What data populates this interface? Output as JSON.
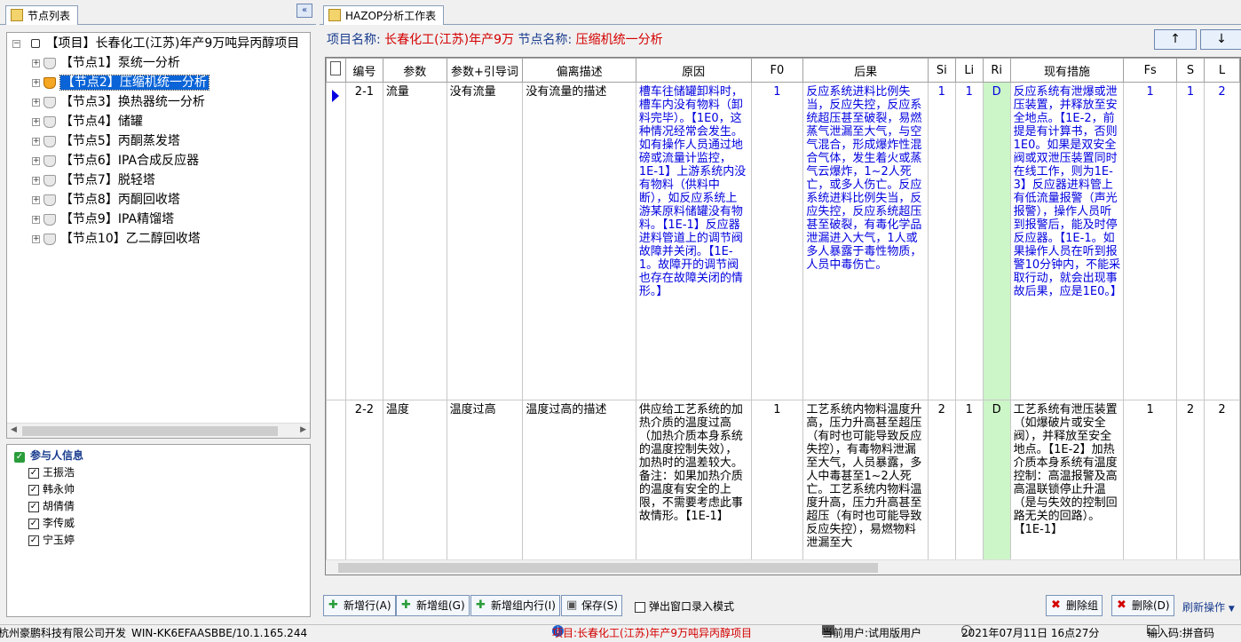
{
  "left_panel": {
    "tab_label": "节点列表",
    "collapse_glyph": "«",
    "tree": {
      "root": "【项目】长春化工(江苏)年产9万吨异丙醇项目",
      "nodes": [
        "【节点1】泵统一分析",
        "【节点2】压缩机统一分析",
        "【节点3】换热器统一分析",
        "【节点4】储罐",
        "【节点5】丙酮蒸发塔",
        "【节点6】IPA合成反应器",
        "【节点7】脱轻塔",
        "【节点8】丙酮回收塔",
        "【节点9】IPA精馏塔",
        "【节点10】乙二醇回收塔"
      ],
      "selected_index": 1
    },
    "participants": {
      "title": "参与人信息",
      "people": [
        "王振浩",
        "韩永帅",
        "胡倩倩",
        "李传威",
        "宁玉婷"
      ]
    }
  },
  "right_panel": {
    "tab_label": "HAZOP分析工作表",
    "project_label": "项目名称:",
    "project_value": "长春化工(江苏)年产9万",
    "node_label": "节点名称:",
    "node_value": "压缩机统一分析",
    "up_arrow": "↑",
    "down_arrow": "↓",
    "columns": [
      "编号",
      "参数",
      "参数+引导词",
      "偏离描述",
      "原因",
      "F0",
      "后果",
      "Si",
      "Li",
      "Ri",
      "现有措施",
      "Fs",
      "S",
      "L"
    ],
    "rows": [
      {
        "id": "2-1",
        "param": "流量",
        "guideword": "没有流量",
        "deviation": "没有流量的描述",
        "cause": "槽车往储罐卸料时，槽车内没有物料（卸料完毕）。【1E0，这种情况经常会发生。如有操作人员通过地磅或流量计监控，1E-1】上游系统内没有物料（供料中断），如反应系统上游某原料储罐没有物料。【1E-1】反应器进料管道上的调节阀故障并关闭。【1E-1。故障开的调节阀也存在故障关闭的情形。】",
        "f0": "1",
        "consequence": "反应系统进料比例失当，反应失控，反应系统超压甚至破裂，易燃蒸气泄漏至大气，与空气混合，形成爆炸性混合气体，发生着火或蒸气云爆炸，1~2人死亡，或多人伤亡。反应系统进料比例失当，反应失控，反应系统超压甚至破裂，有毒化学品泄漏进入大气，1人或多人暴露于毒性物质，人员中毒伤亡。",
        "si": "1",
        "li": "1",
        "ri": "D",
        "measures": "反应系统有泄爆或泄压装置，并释放至安全地点。【1E-2，前提是有计算书，否则1E0。如果是双安全阀或双泄压装置同时在线工作，则为1E-3】反应器进料管上有低流量报警（声光报警），操作人员听到报警后，能及时停反应器。【1E-1。如果操作人员在听到报警10分钟内，不能采取行动，就会出现事故后果，应是1E0。】",
        "fs": "1",
        "s": "1",
        "l": "2"
      },
      {
        "id": "2-2",
        "param": "温度",
        "guideword": "温度过高",
        "deviation": "温度过高的描述",
        "cause": "供应给工艺系统的加热介质的温度过高（加热介质本身系统的温度控制失效），加热时的温差较大。备注：如果加热介质的温度有安全的上限，不需要考虑此事故情形。【1E-1】",
        "f0": "1",
        "consequence": "工艺系统内物料温度升高，压力升高甚至超压（有时也可能导致反应失控），有毒物料泄漏至大气，人员暴露，多人中毒甚至1~2人死亡。工艺系统内物料温度升高，压力升高甚至超压（有时也可能导致反应失控），易燃物料泄漏至大",
        "si": "2",
        "li": "1",
        "ri": "D",
        "measures": "工艺系统有泄压装置（如爆破片或安全阀），并释放至安全地点。【1E-2】加热介质本身系统有温度控制：高温报警及高高温联锁停止升温（是与失效的控制回路无关的回路）。【1E-1】",
        "fs": "1",
        "s": "2",
        "l": "2"
      }
    ],
    "toolbar": {
      "add_row": "新增行(A)",
      "add_group": "新增组(G)",
      "add_group_row": "新增组内行(I)",
      "save": "保存(S)",
      "popup_mode": "弹出窗口录入模式",
      "delete_group": "删除组",
      "delete": "删除(D)",
      "refresh_ops": "刷新操作"
    }
  },
  "status_bar": {
    "developer": "杭州豪鹏科技有限公司开发",
    "host": "WIN-KK6EFAASBBE/10.1.165.244",
    "project": "项目:长春化工(江苏)年产9万吨异丙醇项目",
    "user": "当前用户:试用版用户",
    "datetime": "2021年07月11日 16点27分",
    "input_method": "输入码:拼音码"
  },
  "colors": {
    "accent_blue": "#0a64d8",
    "text_blue": "#0000e0",
    "red": "#d40000",
    "risk_green": "#ccf5c8"
  }
}
